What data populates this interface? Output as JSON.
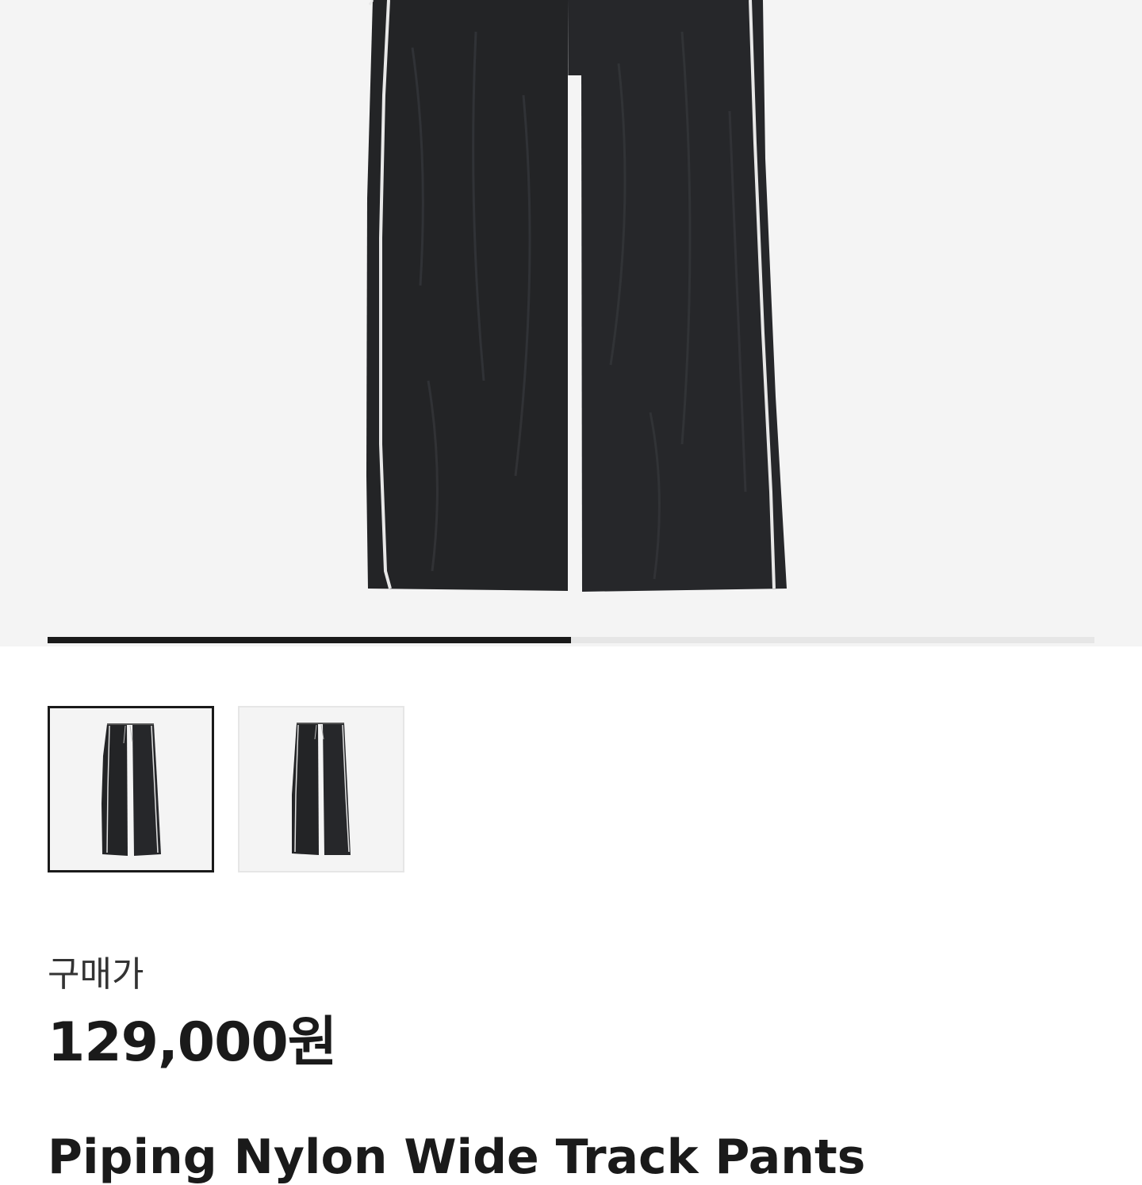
{
  "gallery": {
    "main_image": "black-track-pants-photo",
    "slide_current": 1,
    "slide_total": 2,
    "thumbnails": [
      {
        "image": "black-track-pants-front",
        "selected": true
      },
      {
        "image": "black-track-pants-back",
        "selected": false
      }
    ]
  },
  "price": {
    "label": "구매가",
    "value": "129,000원"
  },
  "product": {
    "name": "Piping Nylon Wide Track Pants"
  },
  "colors": {
    "hero_background": "#f4f4f4",
    "garment": "#232426",
    "piping": "#e8e8e8",
    "progress_active": "#1a1a1a",
    "progress_inactive": "#e6e6e6"
  }
}
